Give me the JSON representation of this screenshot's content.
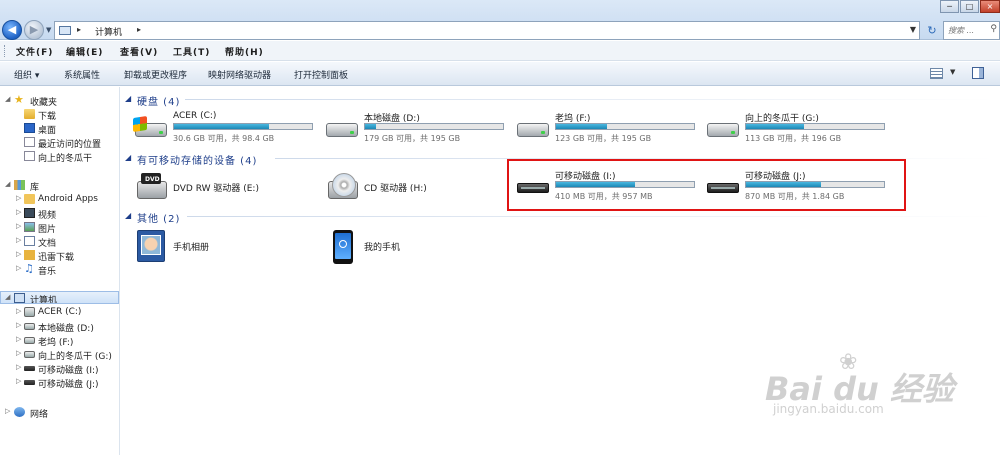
{
  "window": {
    "address": "计算机",
    "search_placeholder": "搜索 ...",
    "min_label": "─",
    "max_label": "□",
    "close_label": "×"
  },
  "menu": [
    {
      "label": "文件(F)"
    },
    {
      "label": "编辑(E)"
    },
    {
      "label": "查看(V)"
    },
    {
      "label": "工具(T)"
    },
    {
      "label": "帮助(H)"
    }
  ],
  "commands": [
    {
      "label": "组织 ▾"
    },
    {
      "label": "系统属性"
    },
    {
      "label": "卸载或更改程序"
    },
    {
      "label": "映射网络驱动器"
    },
    {
      "label": "打开控制面板"
    }
  ],
  "nav": {
    "favorites": "收藏夹",
    "downloads": "下载",
    "desktop": "桌面",
    "recent": "最近访问的位置",
    "xiangshang": "向上的冬瓜干",
    "libraries": "库",
    "android": "Android Apps",
    "videos": "视频",
    "pictures": "图片",
    "documents": "文档",
    "thunder": "迅雷下载",
    "music": "音乐",
    "computer": "计算机",
    "drive_c": "ACER (C:)",
    "drive_d": "本地磁盘 (D:)",
    "drive_f": "老坞 (F:)",
    "drive_g": "向上的冬瓜干 (G:)",
    "drive_i": "可移动磁盘 (I:)",
    "drive_j": "可移动磁盘 (J:)",
    "network": "网络"
  },
  "groups": {
    "hard_disks": "硬盘 (4)",
    "removable": "有可移动存储的设备 (4)",
    "other": "其他 (2)"
  },
  "drives": {
    "c": {
      "name": "ACER (C:)",
      "info": "30.6 GB 可用，共 98.4 GB",
      "used": 0.69
    },
    "d": {
      "name": "本地磁盘 (D:)",
      "info": "179 GB 可用，共 195 GB",
      "used": 0.08
    },
    "f": {
      "name": "老坞 (F:)",
      "info": "123 GB 可用，共 195 GB",
      "used": 0.37
    },
    "g": {
      "name": "向上的冬瓜干 (G:)",
      "info": "113 GB 可用，共 196 GB",
      "used": 0.42
    },
    "e": {
      "name": "DVD RW 驱动器 (E:)"
    },
    "h": {
      "name": "CD 驱动器 (H:)"
    },
    "i": {
      "name": "可移动磁盘 (I:)",
      "info": "410 MB 可用，共 957 MB",
      "used": 0.57
    },
    "j": {
      "name": "可移动磁盘 (J:)",
      "info": "870 MB 可用，共 1.84 GB",
      "used": 0.54
    }
  },
  "other_items": {
    "album": "手机相册",
    "phone": "我的手机"
  },
  "watermark": {
    "brand": "Bai du 经验",
    "url": "jingyan.baidu.com"
  }
}
